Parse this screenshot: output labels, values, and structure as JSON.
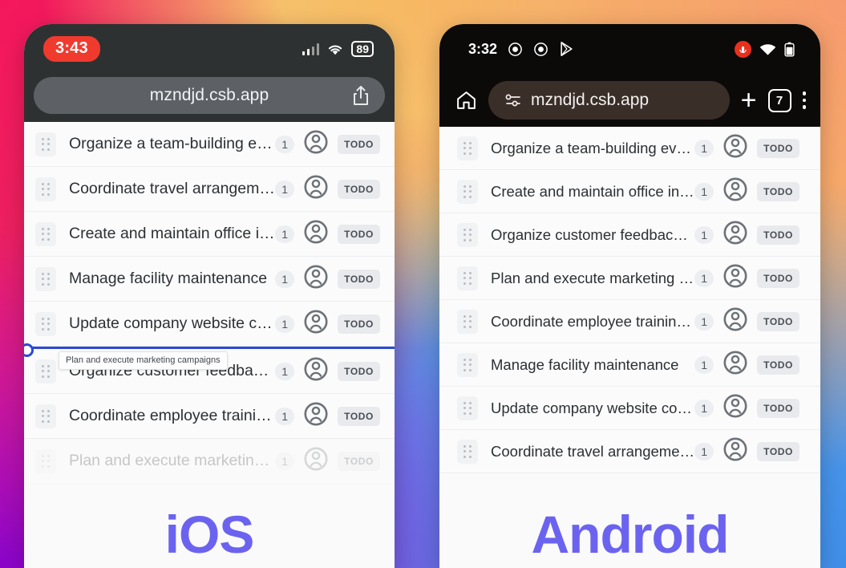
{
  "ios": {
    "status": {
      "time": "3:43",
      "battery": "89",
      "signal_icon": "cellular-signal-icon",
      "wifi_icon": "wifi-icon"
    },
    "browser": {
      "url": "mzndjd.csb.app",
      "share_icon": "share-icon"
    },
    "caption": "iOS",
    "drag_tooltip": "Plan and execute marketing campaigns",
    "tasks": [
      {
        "title": "Organize a team-building event",
        "count": "1",
        "status": "TODO",
        "ghost": false
      },
      {
        "title": "Coordinate travel arrangements",
        "count": "1",
        "status": "TODO",
        "ghost": false
      },
      {
        "title": "Create and maintain office inve…",
        "count": "1",
        "status": "TODO",
        "ghost": false
      },
      {
        "title": "Manage facility maintenance",
        "count": "1",
        "status": "TODO",
        "ghost": false
      },
      {
        "title": "Update company website cont…",
        "count": "1",
        "status": "TODO",
        "ghost": false
      },
      {
        "title": "Organize customer feedback s…",
        "count": "1",
        "status": "TODO",
        "ghost": false
      },
      {
        "title": "Coordinate employee training s…",
        "count": "1",
        "status": "TODO",
        "ghost": false
      },
      {
        "title": "Plan and execute marketing ca…",
        "count": "1",
        "status": "TODO",
        "ghost": true
      }
    ]
  },
  "android": {
    "status": {
      "time": "3:32",
      "icons": [
        "record-circle-icon",
        "record-circle-icon",
        "play-store-icon"
      ],
      "recording_icon": "recording-badge-icon",
      "wifi_icon": "wifi-icon",
      "battery_icon": "battery-icon"
    },
    "browser": {
      "home_icon": "home-icon",
      "site_settings_icon": "site-settings-icon",
      "url": "mzndjd.csb.app",
      "new_tab_label": "+",
      "tab_count": "7",
      "menu_icon": "overflow-menu-icon"
    },
    "caption": "Android",
    "tasks": [
      {
        "title": "Organize a team-building event",
        "count": "1",
        "status": "TODO"
      },
      {
        "title": "Create and maintain office inventory",
        "count": "1",
        "status": "TODO"
      },
      {
        "title": "Organize customer feedback surveys",
        "count": "1",
        "status": "TODO"
      },
      {
        "title": "Plan and execute marketing campai…",
        "count": "1",
        "status": "TODO"
      },
      {
        "title": "Coordinate employee training sessio…",
        "count": "1",
        "status": "TODO"
      },
      {
        "title": "Manage facility maintenance",
        "count": "1",
        "status": "TODO"
      },
      {
        "title": "Update company website content",
        "count": "1",
        "status": "TODO"
      },
      {
        "title": "Coordinate travel arrangements",
        "count": "1",
        "status": "TODO"
      }
    ]
  },
  "colors": {
    "accent_drop": "#2b49d6",
    "caption": "#6b63f0",
    "ios_time_pill": "#f03a2e",
    "android_record": "#e8301d"
  }
}
